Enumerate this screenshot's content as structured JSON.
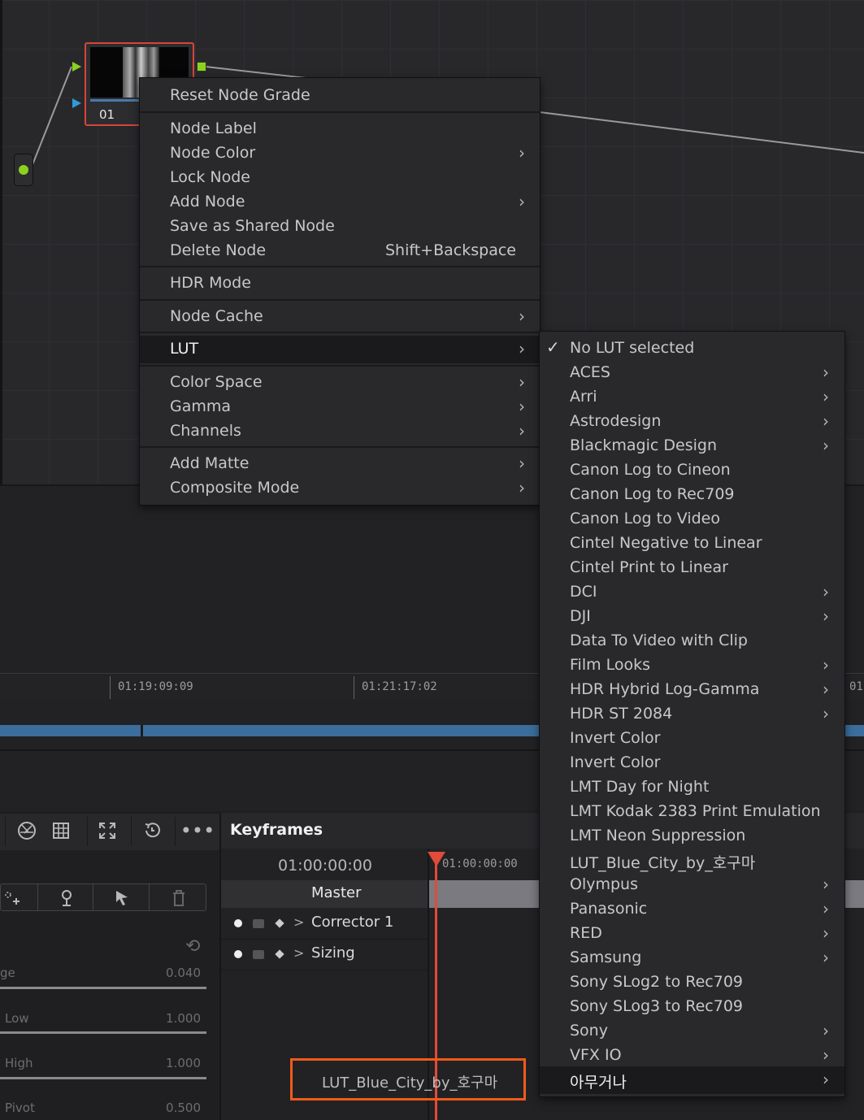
{
  "node": {
    "number": "01"
  },
  "timeline": {
    "timecodes": [
      "01:19:09:09",
      "01:21:17:02",
      "01:"
    ]
  },
  "params": [
    {
      "label": "ge",
      "value": "0.040"
    },
    {
      "label": "Low",
      "value": "1.000"
    },
    {
      "label": "High",
      "value": "1.000"
    },
    {
      "label": "Pivot",
      "value": "0.500"
    }
  ],
  "keyframes": {
    "title": "Keyframes",
    "timecode": "01:00:00:00",
    "ruler_timecode": "01:00:00:00",
    "master": "Master",
    "rows": [
      "Corrector 1",
      "Sizing"
    ],
    "highlighted_lut": "LUT_Blue_City_by_호구마"
  },
  "context_menu": {
    "items": [
      {
        "label": "Reset Node Grade"
      },
      {
        "label": "Node Label"
      },
      {
        "label": "Node Color",
        "submenu": true
      },
      {
        "label": "Lock Node"
      },
      {
        "label": "Add Node",
        "submenu": true
      },
      {
        "label": "Save as Shared Node"
      },
      {
        "label": "Delete Node",
        "shortcut": "Shift+Backspace"
      },
      {
        "label": "HDR Mode"
      },
      {
        "label": "Node Cache",
        "submenu": true
      },
      {
        "label": "LUT",
        "submenu": true,
        "highlighted": true
      },
      {
        "label": "Color Space",
        "submenu": true
      },
      {
        "label": "Gamma",
        "submenu": true
      },
      {
        "label": "Channels",
        "submenu": true
      },
      {
        "label": "Add Matte",
        "submenu": true
      },
      {
        "label": "Composite Mode",
        "submenu": true
      }
    ]
  },
  "lut_menu": {
    "items": [
      {
        "label": "No LUT selected",
        "checked": true
      },
      {
        "label": "ACES",
        "submenu": true
      },
      {
        "label": "Arri",
        "submenu": true
      },
      {
        "label": "Astrodesign",
        "submenu": true
      },
      {
        "label": "Blackmagic Design",
        "submenu": true
      },
      {
        "label": "Canon Log to Cineon"
      },
      {
        "label": "Canon Log to Rec709"
      },
      {
        "label": "Canon Log to Video"
      },
      {
        "label": "Cintel Negative to Linear"
      },
      {
        "label": "Cintel Print to Linear"
      },
      {
        "label": "DCI",
        "submenu": true
      },
      {
        "label": "DJI",
        "submenu": true
      },
      {
        "label": "Data To Video with Clip"
      },
      {
        "label": "Film Looks",
        "submenu": true
      },
      {
        "label": "HDR Hybrid Log-Gamma",
        "submenu": true
      },
      {
        "label": "HDR ST 2084",
        "submenu": true
      },
      {
        "label": "Invert Color"
      },
      {
        "label": "Invert Color"
      },
      {
        "label": "LMT Day for Night"
      },
      {
        "label": "LMT Kodak 2383 Print Emulation"
      },
      {
        "label": "LMT Neon Suppression"
      },
      {
        "label": "LUT_Blue_City_by_호구마"
      },
      {
        "label": "Olympus",
        "submenu": true
      },
      {
        "label": "Panasonic",
        "submenu": true
      },
      {
        "label": "RED",
        "submenu": true
      },
      {
        "label": "Samsung",
        "submenu": true
      },
      {
        "label": "Sony SLog2 to Rec709"
      },
      {
        "label": "Sony SLog3 to Rec709"
      },
      {
        "label": "Sony",
        "submenu": true
      },
      {
        "label": "VFX IO",
        "submenu": true
      },
      {
        "label": "아무거나",
        "submenu": true,
        "highlighted": true
      }
    ]
  }
}
